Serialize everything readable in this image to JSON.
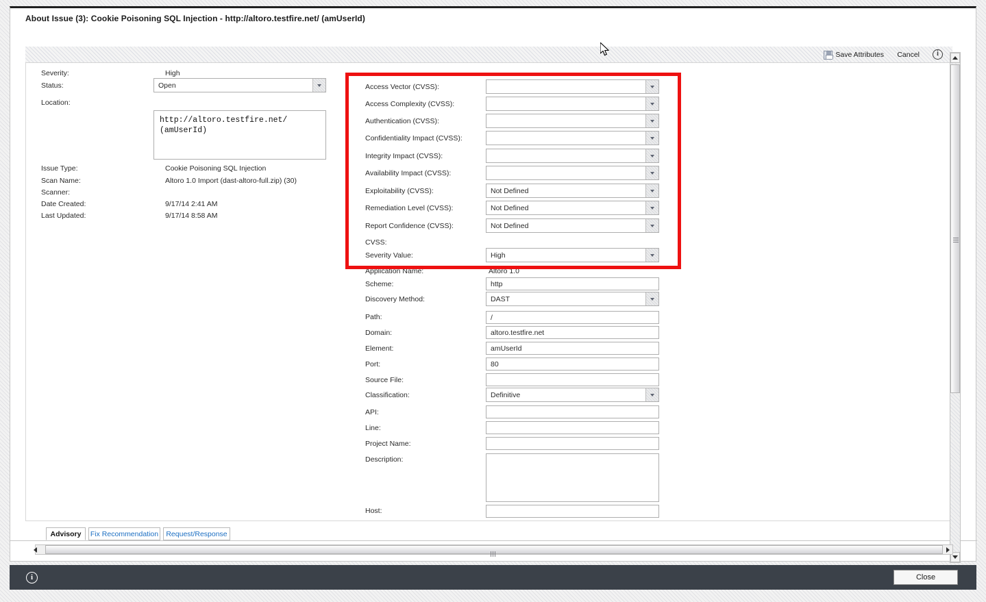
{
  "window": {
    "title": "About Issue (3): Cookie Poisoning SQL Injection - http://altoro.testfire.net/ (amUserId)"
  },
  "toolbar": {
    "save_label": "Save Attributes",
    "cancel_label": "Cancel",
    "save_icon": "floppy-disk-icon",
    "info_icon": "info-circle-icon"
  },
  "left_column": [
    {
      "label": "Severity:",
      "value": "High",
      "type": "text"
    },
    {
      "label": "Status:",
      "value": "Open",
      "type": "select"
    },
    {
      "label": "Location:",
      "value": "http://altoro.testfire.net/\n(amUserId)",
      "type": "textarea"
    },
    {
      "label": "Issue Type:",
      "value": "Cookie Poisoning SQL Injection",
      "type": "text"
    },
    {
      "label": "Scan Name:",
      "value": "Altoro 1.0 Import (dast-altoro-full.zip) (30)",
      "type": "text"
    },
    {
      "label": "Scanner:",
      "value": "",
      "type": "text"
    },
    {
      "label": "Date Created:",
      "value": "9/17/14 2:41 AM",
      "type": "text"
    },
    {
      "label": "Last Updated:",
      "value": "9/17/14 8:58 AM",
      "type": "text"
    }
  ],
  "cvss_section": {
    "highlighted": true,
    "highlight_color": "#ee1111",
    "fields": [
      {
        "label": "Access Vector (CVSS):",
        "value": "",
        "type": "select"
      },
      {
        "label": "Access Complexity (CVSS):",
        "value": "",
        "type": "select"
      },
      {
        "label": "Authentication (CVSS):",
        "value": "",
        "type": "select"
      },
      {
        "label": "Confidentiality Impact (CVSS):",
        "value": "",
        "type": "select"
      },
      {
        "label": "Integrity Impact (CVSS):",
        "value": "",
        "type": "select"
      },
      {
        "label": "Availability Impact (CVSS):",
        "value": "",
        "type": "select"
      },
      {
        "label": "Exploitability (CVSS):",
        "value": "Not Defined",
        "type": "select"
      },
      {
        "label": "Remediation Level (CVSS):",
        "value": "Not Defined",
        "type": "select"
      },
      {
        "label": "Report Confidence (CVSS):",
        "value": "Not Defined",
        "type": "select"
      },
      {
        "label": "CVSS:",
        "value": "",
        "type": "text"
      },
      {
        "label": "Severity Value:",
        "value": "High",
        "type": "select"
      }
    ]
  },
  "detail_section": {
    "fields": [
      {
        "label": "Application Name:",
        "value": "Altoro 1.0",
        "type": "text"
      },
      {
        "label": "Scheme:",
        "value": "http",
        "type": "input"
      },
      {
        "label": "Discovery Method:",
        "value": "DAST",
        "type": "select"
      },
      {
        "label": "Path:",
        "value": "/",
        "type": "input"
      },
      {
        "label": "Domain:",
        "value": "altoro.testfire.net",
        "type": "input"
      },
      {
        "label": "Element:",
        "value": "amUserId",
        "type": "input"
      },
      {
        "label": "Port:",
        "value": "80",
        "type": "input"
      },
      {
        "label": "Source File:",
        "value": "",
        "type": "input"
      },
      {
        "label": "Classification:",
        "value": "Definitive",
        "type": "select"
      },
      {
        "label": "API:",
        "value": "",
        "type": "input"
      },
      {
        "label": "Line:",
        "value": "",
        "type": "input"
      },
      {
        "label": "Project Name:",
        "value": "",
        "type": "input"
      },
      {
        "label": "Description:",
        "value": "",
        "type": "textarea"
      },
      {
        "label": "Host:",
        "value": "",
        "type": "input"
      }
    ]
  },
  "tabs": [
    {
      "label": "Advisory",
      "active": true
    },
    {
      "label": "Fix Recommendation",
      "active": false
    },
    {
      "label": "Request/Response",
      "active": false
    }
  ],
  "footer": {
    "info_icon": "info-circle-icon",
    "close_label": "Close"
  }
}
